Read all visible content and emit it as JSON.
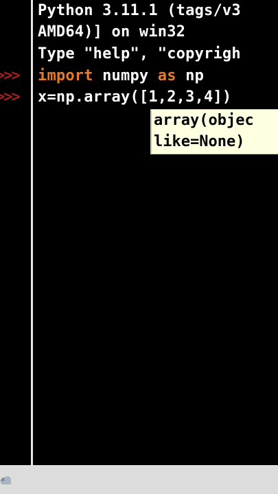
{
  "shell": {
    "lines": [
      "Python 3.11.1 (tags/v3",
      "AMD64)] on win32",
      "Type \"help\", \"copyrigh"
    ],
    "prompt": ">>>",
    "input1": {
      "keyword1": "import",
      "text1": " numpy ",
      "keyword2": "as",
      "text2": " np"
    },
    "input2": "x=np.array([1,2,3,4])"
  },
  "calltip": {
    "line1": "array(objec",
    "line2": "like=None)"
  },
  "taskbar": {
    "icon": "cloud-icon"
  },
  "colors": {
    "background": "#000000",
    "text": "#ffffff",
    "prompt": "#a02020",
    "keyword": "#e87a2a",
    "calltip_bg": "#ffffe1"
  }
}
